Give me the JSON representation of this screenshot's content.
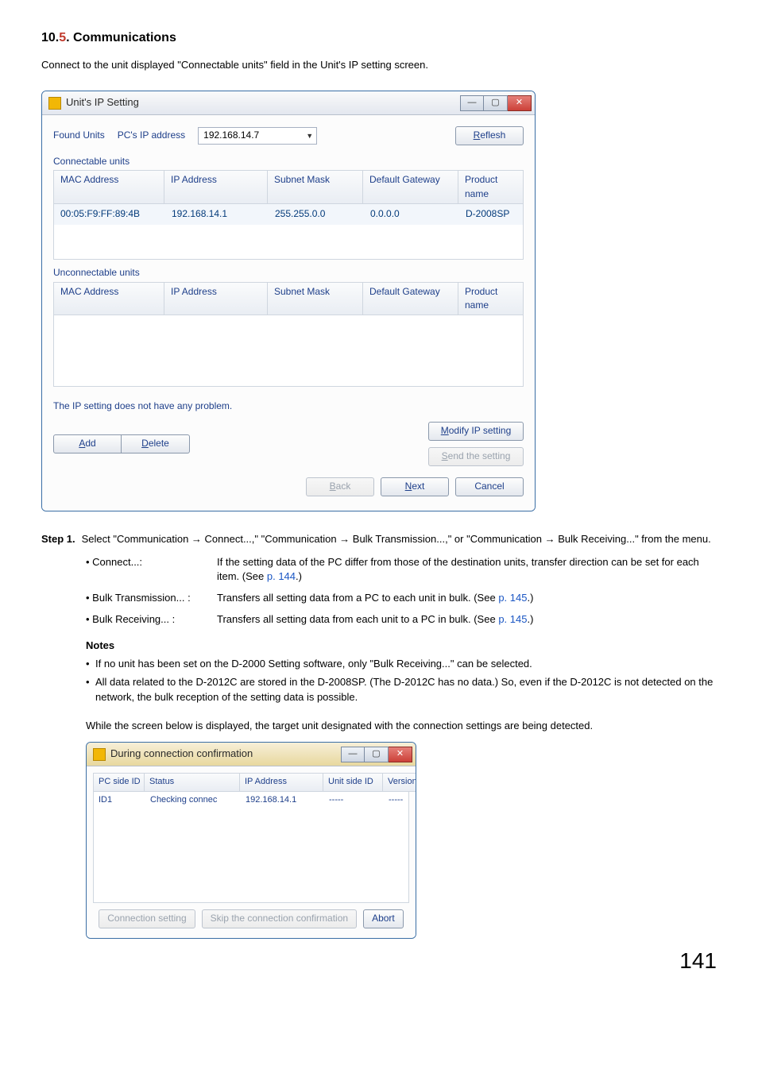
{
  "section": {
    "prefix": "10.",
    "red": "5",
    "suffix": ". Communications"
  },
  "intro": "Connect to the unit displayed \"Connectable units\" field in the Unit's IP setting screen.",
  "ipwin": {
    "title": "Unit's IP Setting",
    "found_units_label": "Found Units",
    "pc_ip_label": "PC's IP address",
    "pc_ip_value": "192.168.14.7",
    "refresh": "Reflesh",
    "refresh_u": "R",
    "connectable_label": "Connectable units",
    "cols": {
      "mac": "MAC Address",
      "ip": "IP Address",
      "mask": "Subnet Mask",
      "gw": "Default Gateway",
      "prod": "Product name"
    },
    "row": {
      "mac": "00:05:F9:FF:89:4B",
      "ip": "192.168.14.1",
      "mask": "255.255.0.0",
      "gw": "0.0.0.0",
      "prod": "D-2008SP"
    },
    "unconnectable_label": "Unconnectable units",
    "status": "The IP setting does not have any problem.",
    "add": "Add",
    "add_u": "A",
    "delete": "Delete",
    "delete_u": "D",
    "modify": "Modify IP setting",
    "modify_u": "M",
    "send": "Send the setting",
    "send_u": "S",
    "back": "Back",
    "back_u": "B",
    "next": "Next",
    "next_u": "N",
    "cancel": "Cancel"
  },
  "step": {
    "label": "Step 1.",
    "body_a": "Select  \"Communication → Connect...,\" \"Communication → Bulk  Transmission...,\"  or \"Communication  →  Bulk Receiving...\" from the menu."
  },
  "defs": {
    "connect_term": "• Connect...:",
    "connect_body_a": "If the setting data of the PC differ from those of the destination units, transfer direction can be set for each item. (See ",
    "connect_link": "p. 144",
    "connect_body_b": ".)",
    "bulktx_term": "• Bulk Transmission... :",
    "bulktx_body_a": "Transfers all setting data from a PC to each unit in bulk. (See ",
    "bulktx_link": "p. 145",
    "bulktx_body_b": ".)",
    "bulkrx_term": "• Bulk Receiving... :",
    "bulkrx_body_a": "Transfers all setting data from each unit to a PC in bulk. (See ",
    "bulkrx_link": "p. 145",
    "bulkrx_body_b": ".)"
  },
  "notes": {
    "heading": "Notes",
    "n1": "If no unit has been set on the D-2000 Setting software, only \"Bulk Receiving...\" can be selected.",
    "n2": "All data related to the D-2012C are stored in the D-2008SP. (The D-2012C has no data.) So, even if the D-2012C is not detected on the network, the bulk reception of the setting data is possible."
  },
  "para": "While the screen below is displayed, the target unit designated with the connection settings are being detected.",
  "connwin": {
    "title": "During connection confirmation",
    "cols": {
      "pcid": "PC side ID",
      "status": "Status",
      "ip": "IP Address",
      "unitid": "Unit side ID",
      "ver": "Version"
    },
    "row": {
      "pcid": "ID1",
      "status": "Checking connec",
      "ip": "192.168.14.1",
      "unitid": "-----",
      "ver": "-----"
    },
    "conn_setting": "Connection setting",
    "skip": "Skip the connection confirmation",
    "abort": "Abort"
  },
  "page": "141"
}
